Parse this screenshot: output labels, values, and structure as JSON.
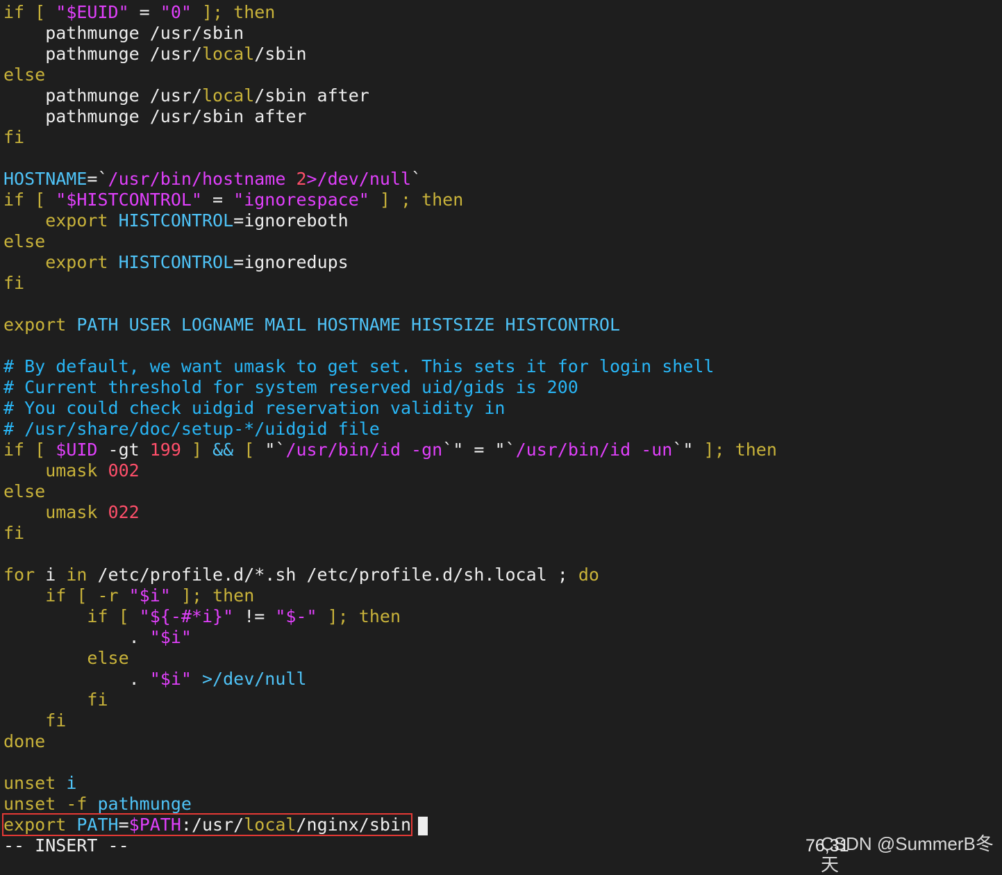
{
  "colors": {
    "background": "#1e1e1e",
    "default": "#eeeeee",
    "keyword": "#c9b33a",
    "string": "#e040fb",
    "identifier": "#4fc3f7",
    "comment": "#29b6f6",
    "number": "#ff4f6a",
    "highlight_border": "#e53935"
  },
  "lines": [
    [
      {
        "text": "if",
        "color": "keyword"
      },
      {
        "text": " [ ",
        "color": "keyword"
      },
      {
        "text": "\"$EUID\"",
        "color": "string"
      },
      {
        "text": " = ",
        "color": "default"
      },
      {
        "text": "\"0\"",
        "color": "string"
      },
      {
        "text": " ]; ",
        "color": "keyword"
      },
      {
        "text": "then",
        "color": "keyword"
      }
    ],
    [
      {
        "text": "    pathmunge /usr/sbin",
        "color": "default"
      }
    ],
    [
      {
        "text": "    pathmunge /usr/",
        "color": "default"
      },
      {
        "text": "local",
        "color": "keyword"
      },
      {
        "text": "/sbin",
        "color": "default"
      }
    ],
    [
      {
        "text": "else",
        "color": "keyword"
      }
    ],
    [
      {
        "text": "    pathmunge /usr/",
        "color": "default"
      },
      {
        "text": "local",
        "color": "keyword"
      },
      {
        "text": "/sbin after",
        "color": "default"
      }
    ],
    [
      {
        "text": "    pathmunge /usr/sbin after",
        "color": "default"
      }
    ],
    [
      {
        "text": "fi",
        "color": "keyword"
      }
    ],
    [],
    [
      {
        "text": "HOSTNAME",
        "color": "identifier"
      },
      {
        "text": "=`",
        "color": "default"
      },
      {
        "text": "/usr/bin/hostname ",
        "color": "string"
      },
      {
        "text": "2",
        "color": "number"
      },
      {
        "text": ">/dev/null",
        "color": "string"
      },
      {
        "text": "`",
        "color": "default"
      }
    ],
    [
      {
        "text": "if",
        "color": "keyword"
      },
      {
        "text": " [ ",
        "color": "keyword"
      },
      {
        "text": "\"$HISTCONTROL\"",
        "color": "string"
      },
      {
        "text": " = ",
        "color": "default"
      },
      {
        "text": "\"ignorespace\"",
        "color": "string"
      },
      {
        "text": " ] ; ",
        "color": "keyword"
      },
      {
        "text": "then",
        "color": "keyword"
      }
    ],
    [
      {
        "text": "    export ",
        "color": "keyword"
      },
      {
        "text": "HISTCONTROL",
        "color": "identifier"
      },
      {
        "text": "=ignoreboth",
        "color": "default"
      }
    ],
    [
      {
        "text": "else",
        "color": "keyword"
      }
    ],
    [
      {
        "text": "    export ",
        "color": "keyword"
      },
      {
        "text": "HISTCONTROL",
        "color": "identifier"
      },
      {
        "text": "=ignoredups",
        "color": "default"
      }
    ],
    [
      {
        "text": "fi",
        "color": "keyword"
      }
    ],
    [],
    [
      {
        "text": "export ",
        "color": "keyword"
      },
      {
        "text": "PATH USER LOGNAME MAIL HOSTNAME HISTSIZE HISTCONTROL",
        "color": "identifier"
      }
    ],
    [],
    [
      {
        "text": "# By default, we want umask to get set. This sets it for login shell",
        "color": "comment"
      }
    ],
    [
      {
        "text": "# Current threshold for system reserved uid/gids is 200",
        "color": "comment"
      }
    ],
    [
      {
        "text": "# You could check uidgid reservation validity in",
        "color": "comment"
      }
    ],
    [
      {
        "text": "# /usr/share/doc/setup-*/uidgid file",
        "color": "comment"
      }
    ],
    [
      {
        "text": "if",
        "color": "keyword"
      },
      {
        "text": " [ ",
        "color": "keyword"
      },
      {
        "text": "$UID",
        "color": "string"
      },
      {
        "text": " -gt ",
        "color": "default"
      },
      {
        "text": "199",
        "color": "number"
      },
      {
        "text": " ] ",
        "color": "keyword"
      },
      {
        "text": "&&",
        "color": "identifier"
      },
      {
        "text": " [ ",
        "color": "keyword"
      },
      {
        "text": "\"`",
        "color": "default"
      },
      {
        "text": "/usr/bin/id -gn",
        "color": "string"
      },
      {
        "text": "`\"",
        "color": "default"
      },
      {
        "text": " = ",
        "color": "default"
      },
      {
        "text": "\"`",
        "color": "default"
      },
      {
        "text": "/usr/bin/id -un",
        "color": "string"
      },
      {
        "text": "`\"",
        "color": "default"
      },
      {
        "text": " ]; ",
        "color": "keyword"
      },
      {
        "text": "then",
        "color": "keyword"
      }
    ],
    [
      {
        "text": "    umask ",
        "color": "keyword"
      },
      {
        "text": "002",
        "color": "number"
      }
    ],
    [
      {
        "text": "else",
        "color": "keyword"
      }
    ],
    [
      {
        "text": "    umask ",
        "color": "keyword"
      },
      {
        "text": "022",
        "color": "number"
      }
    ],
    [
      {
        "text": "fi",
        "color": "keyword"
      }
    ],
    [],
    [
      {
        "text": "for ",
        "color": "keyword"
      },
      {
        "text": "i ",
        "color": "default"
      },
      {
        "text": "in ",
        "color": "keyword"
      },
      {
        "text": "/etc/profile.d/*.sh /etc/profile.d/sh.local ",
        "color": "default"
      },
      {
        "text": "; ",
        "color": "default"
      },
      {
        "text": "do",
        "color": "keyword"
      }
    ],
    [
      {
        "text": "    if",
        "color": "keyword"
      },
      {
        "text": " [ ",
        "color": "keyword"
      },
      {
        "text": "-r ",
        "color": "keyword"
      },
      {
        "text": "\"$i\"",
        "color": "string"
      },
      {
        "text": " ]; ",
        "color": "keyword"
      },
      {
        "text": "then",
        "color": "keyword"
      }
    ],
    [
      {
        "text": "        if",
        "color": "keyword"
      },
      {
        "text": " [ ",
        "color": "keyword"
      },
      {
        "text": "\"${-#*i}\"",
        "color": "string"
      },
      {
        "text": " != ",
        "color": "default"
      },
      {
        "text": "\"$-\"",
        "color": "string"
      },
      {
        "text": " ]; ",
        "color": "keyword"
      },
      {
        "text": "then",
        "color": "keyword"
      }
    ],
    [
      {
        "text": "            . ",
        "color": "default"
      },
      {
        "text": "\"$i\"",
        "color": "string"
      }
    ],
    [
      {
        "text": "        else",
        "color": "keyword"
      }
    ],
    [
      {
        "text": "            . ",
        "color": "default"
      },
      {
        "text": "\"$i\"",
        "color": "string"
      },
      {
        "text": " >/dev/null",
        "color": "identifier"
      }
    ],
    [
      {
        "text": "        fi",
        "color": "keyword"
      }
    ],
    [
      {
        "text": "    fi",
        "color": "keyword"
      }
    ],
    [
      {
        "text": "done",
        "color": "keyword"
      }
    ],
    [],
    [
      {
        "text": "unset ",
        "color": "keyword"
      },
      {
        "text": "i",
        "color": "identifier"
      }
    ],
    [
      {
        "text": "unset ",
        "color": "keyword"
      },
      {
        "text": "-f ",
        "color": "keyword"
      },
      {
        "text": "pathmunge",
        "color": "identifier"
      }
    ]
  ],
  "edit_line": [
    {
      "text": "export ",
      "color": "keyword"
    },
    {
      "text": "PATH",
      "color": "identifier"
    },
    {
      "text": "=",
      "color": "default"
    },
    {
      "text": "$PATH",
      "color": "string"
    },
    {
      "text": ":/usr/",
      "color": "default"
    },
    {
      "text": "local",
      "color": "keyword"
    },
    {
      "text": "/nginx/sbin",
      "color": "default"
    }
  ],
  "status": {
    "mode": "-- INSERT --",
    "position": "76,31"
  },
  "watermark": "CSDN @SummerB冬天"
}
